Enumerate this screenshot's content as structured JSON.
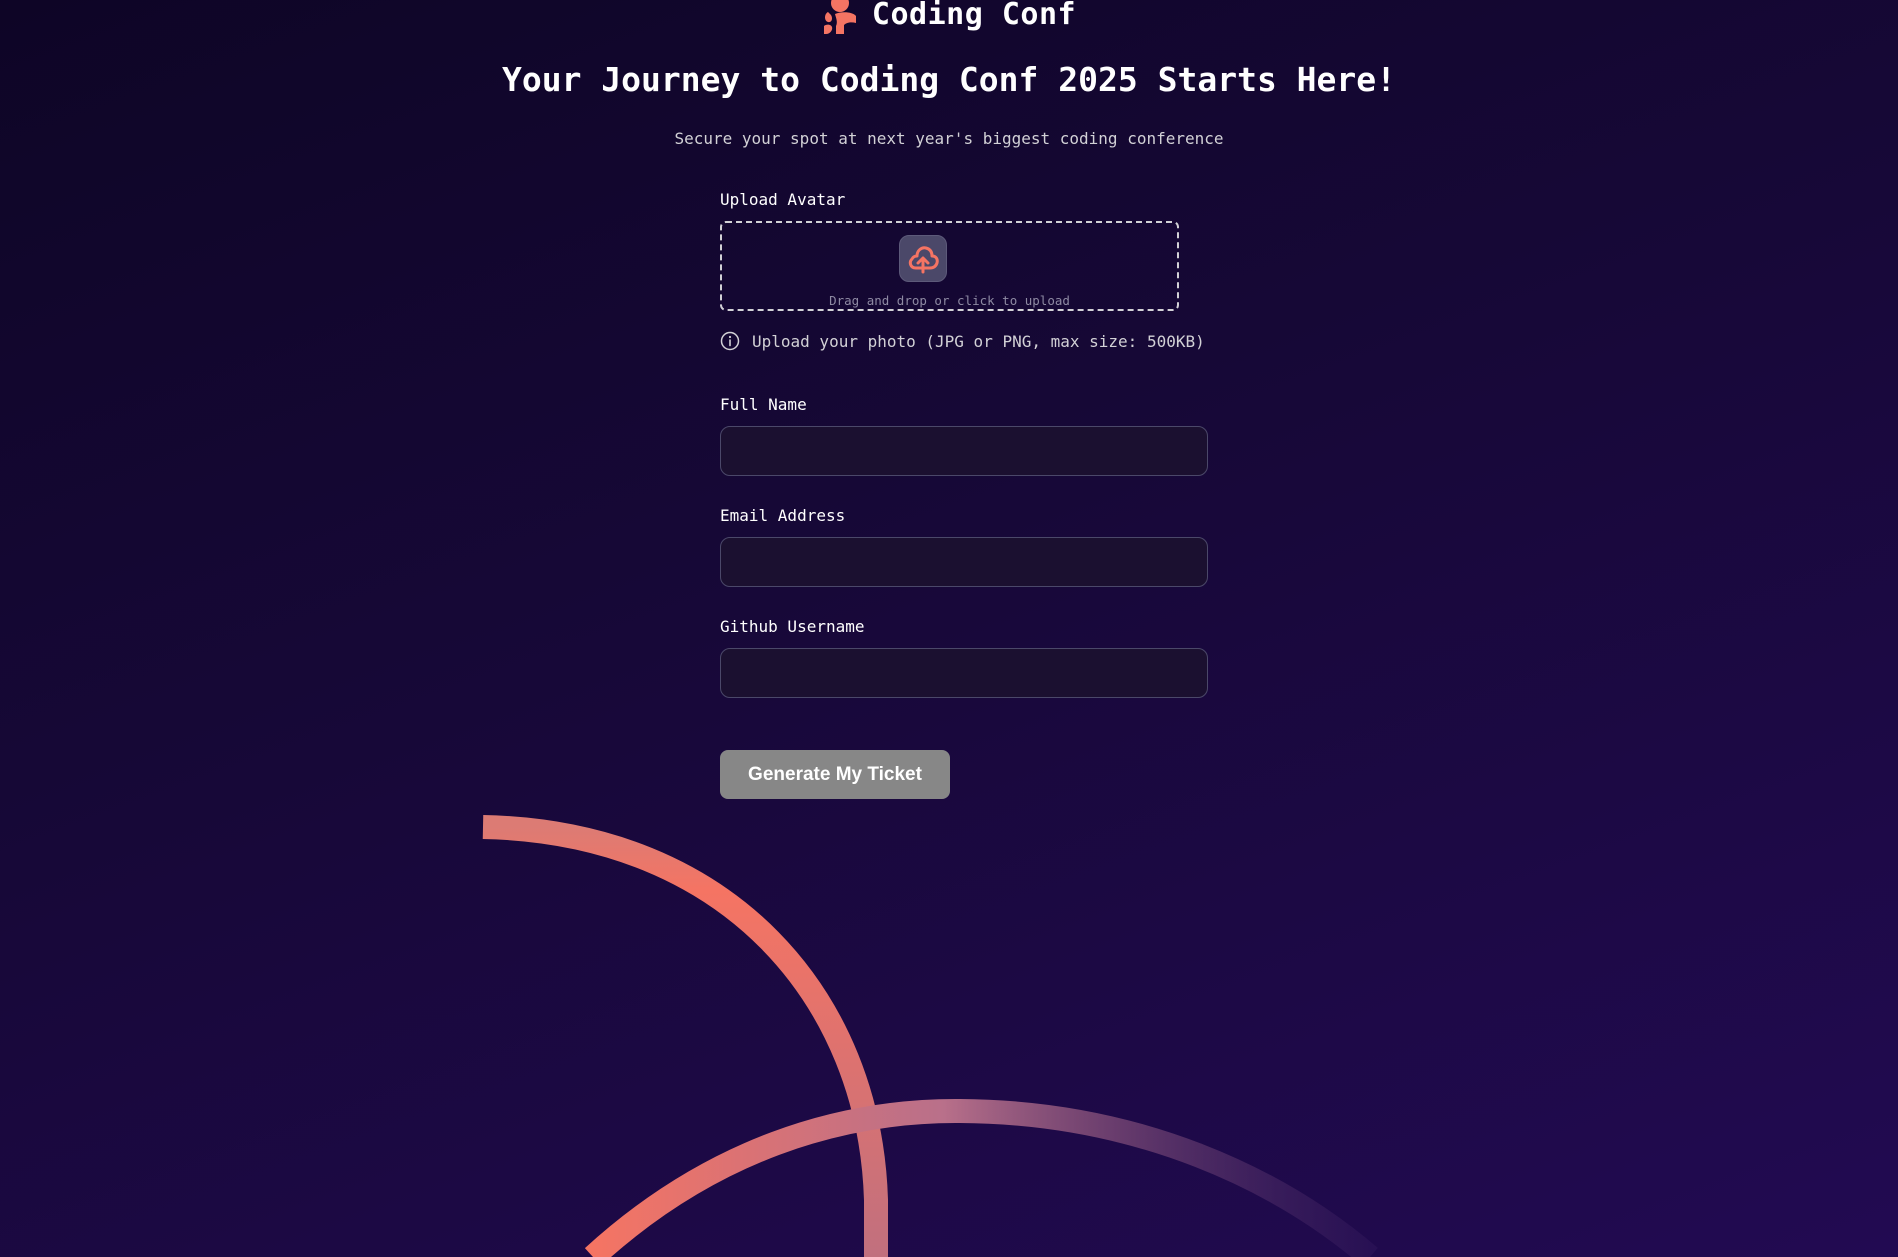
{
  "brand": {
    "logo_icon": "coding-conf-logo-icon",
    "name": "Coding Conf",
    "accent_color": "#f57463"
  },
  "header": {
    "title": "Your Journey to Coding Conf 2025 Starts Here!",
    "subtitle": "Secure your spot at next year's biggest coding conference"
  },
  "form": {
    "avatar": {
      "label": "Upload Avatar",
      "dropzone_text": "Drag and drop or click to upload",
      "icon": "cloud-upload-icon",
      "hint": "Upload your photo (JPG or PNG, max size: 500KB)",
      "hint_icon": "info-icon"
    },
    "full_name": {
      "label": "Full Name",
      "value": "",
      "placeholder": ""
    },
    "email": {
      "label": "Email Address",
      "value": "",
      "placeholder": ""
    },
    "github": {
      "label": "Github Username",
      "value": "",
      "placeholder": ""
    },
    "submit_label": "Generate My Ticket"
  },
  "colors": {
    "background": "#170838",
    "button": "#878787",
    "input_background": "#1b1030",
    "input_border": "#4b4869"
  }
}
